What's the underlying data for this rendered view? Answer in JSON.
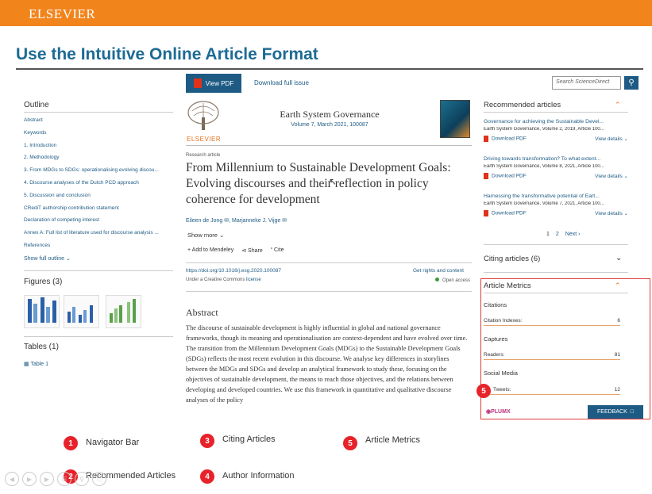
{
  "header": {
    "brand": "ELSEVIER",
    "slide_title": "Use the Intuitive Online Article Format"
  },
  "toolbar": {
    "view_pdf": "View PDF",
    "download_issue": "Download full issue",
    "search_placeholder": "Search ScienceDirect"
  },
  "outline": {
    "heading": "Outline",
    "items": [
      "Abstract",
      "Keywords",
      "1. Introduction",
      "2. Methodology",
      "3. From MDGs to SDGs: operationalising evolving discou...",
      "4. Discourse analyses of the Dutch PCD approach",
      "5. Discussion and conclusion",
      "CRediT authorship contribution statement",
      "Declaration of competing interest",
      "Annex A: Full list of literature used for discourse analysis ...",
      "References"
    ],
    "show_full": "Show full outline"
  },
  "figures": {
    "heading": "Figures (3)"
  },
  "tables": {
    "heading": "Tables (1)",
    "item": "Table 1"
  },
  "article": {
    "logo_text": "ELSEVIER",
    "journal": "Earth System Governance",
    "volume": "Volume 7, March 2021, 100087",
    "type": "Research article",
    "title": "From Millennium to Sustainable Development Goals: Evolving discourses and their reflection in policy coherence for development",
    "authors": "Eileen de Jong ✉, Marjanneke J. Vijge ✉",
    "show_more": "Show more",
    "add_mendeley": "Add to Mendeley",
    "share": "Share",
    "cite": "Cite",
    "doi": "https://doi.org/10.1016/j.esg.2020.100087",
    "rights": "Get rights and content",
    "license_prefix": "Under a Creative Commons",
    "license_link": "license",
    "open_access": "Open access",
    "abstract_heading": "Abstract",
    "abstract": "The discourse of sustainable development is highly influential in global and national governance frameworks, though its meaning and operationalisation are context-dependent and have evolved over time. The transition from the Millennium Development Goals (MDGs) to the Sustainable Development Goals (SDGs) reflects the most recent evolution in this discourse. We analyse key differences in storylines between the MDGs and SDGs and develop an analytical framework to study these, focusing on the objectives of sustainable development, the means to reach those objectives, and the relations between developing and developed countries. We use this framework in quantitative and qualitative discourse analyses of the policy"
  },
  "recommended": {
    "heading": "Recommended articles",
    "items": [
      {
        "title": "Governance for achieving the Sustainable Devel...",
        "source": "Earth System Governance, Volume 2, 2019, Article 100...",
        "pdf": "Download PDF",
        "details": "View details"
      },
      {
        "title": "Driving towards transformation? To what extent...",
        "source": "Earth System Governance, Volume 8, 2021, Article 100...",
        "pdf": "Download PDF",
        "details": "View details"
      },
      {
        "title": "Harnessing the transformative potential of Eart...",
        "source": "Earth System Governance, Volume 7, 2021, Article 100...",
        "pdf": "Download PDF",
        "details": "View details"
      }
    ],
    "pages": [
      "1",
      "2"
    ],
    "next": "Next"
  },
  "citing": {
    "heading": "Citing articles (6)"
  },
  "metrics": {
    "heading": "Article Metrics",
    "citations_label": "Citations",
    "citation_indexes_label": "Citation Indexes:",
    "citation_indexes_value": "6",
    "captures_label": "Captures",
    "readers_label": "Readers:",
    "readers_value": "81",
    "social_label": "Social Media",
    "tweets_label": "Tweets:",
    "tweets_value": "12",
    "plumx": "PLUMX",
    "feedback": "FEEDBACK"
  },
  "legend": [
    {
      "num": "1",
      "label": "Navigator Bar"
    },
    {
      "num": "2",
      "label": "Recommended Articles"
    },
    {
      "num": "3",
      "label": "Citing Articles"
    },
    {
      "num": "4",
      "label": "Author Information"
    },
    {
      "num": "5",
      "label": "Article Metrics"
    }
  ],
  "colors": {
    "orange": "#f2841c",
    "blue": "#1e5b84",
    "title_blue": "#1d6b95",
    "marker_red": "#e8222a"
  }
}
